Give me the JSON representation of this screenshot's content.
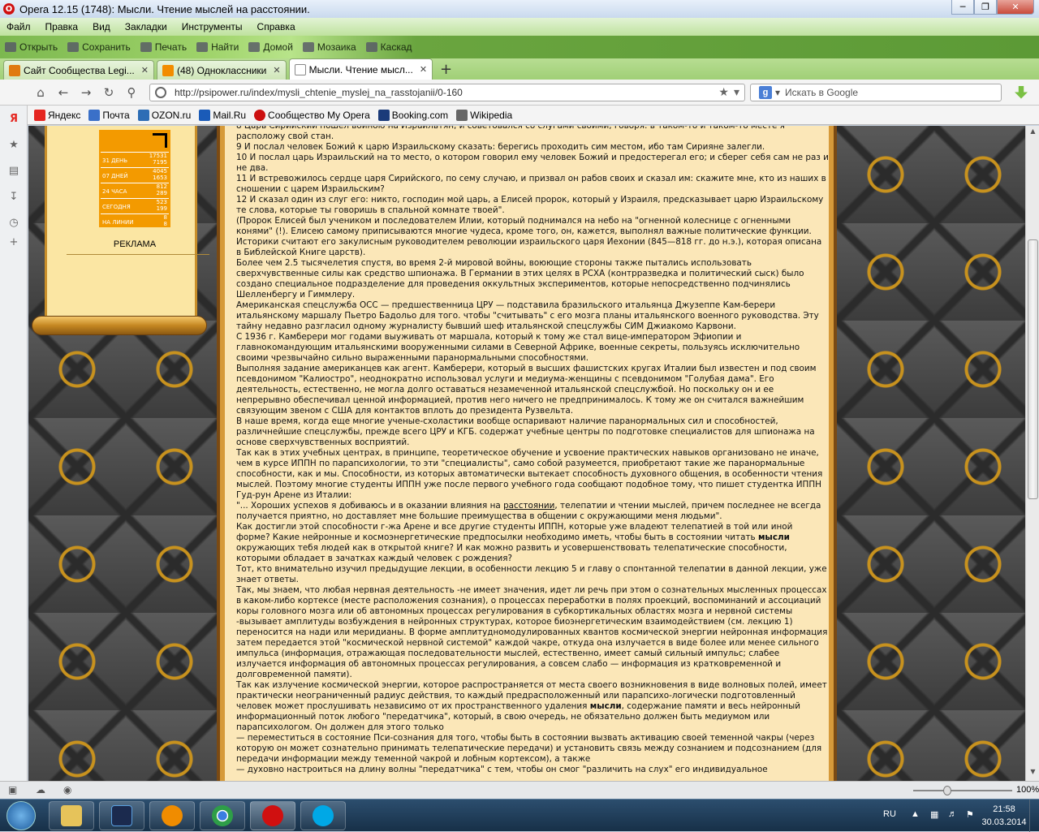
{
  "window": {
    "title": "Opera 12.15 (1748): Мысли. Чтение мыслей на расстоянии.",
    "controls": [
      "minimize",
      "maximize",
      "close"
    ]
  },
  "menu": [
    "Файл",
    "Правка",
    "Вид",
    "Закладки",
    "Инструменты",
    "Справка"
  ],
  "toolbar": [
    "Открыть",
    "Сохранить",
    "Печать",
    "Найти",
    "Домой",
    "Мозаика",
    "Каскад"
  ],
  "tabs": [
    {
      "label": "Сайт Сообщества Legi...",
      "icon": "legion-favicon",
      "color": "#e07a10"
    },
    {
      "label": "(48) Одноклассники",
      "icon": "ok-favicon",
      "color": "#f28c00"
    },
    {
      "label": "Мысли. Чтение мысл...",
      "icon": "page-favicon",
      "color": "#ffffff",
      "active": true
    }
  ],
  "address": {
    "url": "http://psipower.ru/index/mysli_chtenie_myslej_na_rasstojanii/0-160",
    "search_placeholder": "Искать в Google"
  },
  "bookmarks": [
    {
      "label": "Яндекс",
      "icon": "yandex-icon",
      "color": "#e52620"
    },
    {
      "label": "Почта",
      "icon": "mail-icon",
      "color": "#3a70c8"
    },
    {
      "label": "OZON.ru",
      "icon": "ozon-icon",
      "color": "#2d6db5"
    },
    {
      "label": "Mail.Ru",
      "icon": "mailru-icon",
      "color": "#1a5bb8"
    },
    {
      "label": "Сообщество My Opera",
      "icon": "opera-icon",
      "color": "#cc1010"
    },
    {
      "label": "Booking.com",
      "icon": "booking-icon",
      "color": "#1b3b7a"
    },
    {
      "label": "Wikipedia",
      "icon": "wikipedia-icon",
      "color": "#666666"
    }
  ],
  "counter": {
    "rows": [
      {
        "label": "31 ДЕНЬ",
        "v1": "17531",
        "v2": "7195"
      },
      {
        "label": "07 ДНЕЙ",
        "v1": "4045",
        "v2": "1653"
      },
      {
        "label": "24 ЧАСА",
        "v1": "812",
        "v2": "289"
      },
      {
        "label": "СЕГОДНЯ",
        "v1": "523",
        "v2": "199"
      },
      {
        "label": "НА ЛИНИИ",
        "v1": "8",
        "v2": "8"
      }
    ],
    "color": "#f39a00"
  },
  "sidebar": {
    "ad_label": "РЕКЛАМА"
  },
  "article": {
    "paragraphs": [
      "8 Царь Сирийский пошел войною на Израильтян, и советовался со слугами своими, говоря: в таком-то и таком-то месте я расположу свой стан.",
      "9 И послал человек Божий к царю Израильскому сказать: берегись проходить сим местом, ибо там Сирияне залегли.",
      "10 И послал царь Израильский на то место, о котором говорил ему человек Божий и предостерегал его; и сберег себя сам не раз и не два.",
      "11 И встревожилось сердце царя Сирийского, по сему случаю, и призвал он рабов своих и сказал им: скажите мне, кто из наших в сношении с царем Израильским?",
      "12 И сказал один из слуг его: никто, господин мой царь, а Елисей пророк, который у Израиля, предсказывает царю Израильскому те слова, которые ты говоришь в спальной комнате твоей\".",
      "(Пророк Елисей был учеником и последователем Илии, который поднимался на небо на \"огненной колеснице с огненными конями\" (!). Елисею самому приписываются многие чудеса, кроме того, он, кажется, выполнял важные политические функции. Историки считают его закулисным руководителем революции израильского царя Иехонии (845—818 гг. до н.э.), которая описана в Библейской Книге царств).",
      "Более чем 2.5 тысячелетия спустя, во время 2-й мировой войны, воюющие стороны также пытались использовать сверхчувственные силы как средство шпионажа. В Германии в этих целях в РСХА (контрразведка и политический сыск) было создано специальное подразделение для проведения оккультных экспериментов, которые непосредственно подчинялись Шелленбергу и Гиммлеру.",
      "Американская спецслужба ОСС — предшественница ЦРУ — подставила бразильского итальянца Джузеппе Кам-берери итальянскому маршалу Пьетро Бадольо для того. чтобы \"считывать\" с его мозга планы итальянского военного руководства. Эту тайну недавно разгласил одному журналисту бывший шеф итальянской спецслужбы СИМ Джиакомо Карвони.",
      "С 1936 г. Камберери мог годами выуживать от маршала, который к тому же стал вице-императором Эфиопии и главнокомандующим итальянскими вооруженными силами в Северной Африке, военные секреты, пользуясь исключительно своими чрезвычайно сильно выраженными паранормальными способностями.",
      "Выполняя задание американцев как агент. Камберери, который в высших фашистских кругах Италии был известен и под своим псевдонимом \"Калиостро\", неоднократно использовал услуги и медиума-женщины с псевдонимом \"Голубая дама\". Его деятельность, естественно, не могла долго оставаться незамеченной итальянской спецслужбой. Но поскольку он и ее непрерывно обеспечивал ценной информацией, против него ничего не предпринималось. К тому же он считался важнейшим связующим звеном с США для контактов вплоть до президента Рузвельта.",
      "В наше время, когда еще многие ученые-схоластики вообще оспаривают наличие паранормальных сил и способностей, различнейшие спецслужбы, прежде всего ЦРУ и КГБ. содержат учебные центры по подготовке специалистов для шпионажа на основе сверхчувственных восприятий.",
      "Так как в этих учебных центрах, в принципе, теоретическое обучение и усвоение практических навыков организовано не иначе, чем в курсе ИППН по парапсихологии, то эти \"специалисты\", само собой разумеется, приобретают такие же паранормальные способности, как и мы. Способности, из которых автоматически вытекает способность духовного общения, в особенности чтения мыслей. Поэтому многие студенты ИППН уже после первого учебного года сообщают подобное тому, что пишет студентка ИППН Гуд-рун Арене из Италии:",
      "\"... Хороших успехов я добиваюсь и в оказании влияния на [расстоянии], телепатии и чтении мыслей, причем последнее не всегда получается приятно, но доставляет мне большие преимущества в общении с окружающими меня людьми\".",
      "Как достигли этой способности г-жа Арене и все другие студенты ИППН, которые уже владеют телепатией в той или иной форме? Какие нейронные и космоэнергетические предпосылки необходимо иметь, чтобы быть в состоянии читать {мысли} окружающих тебя людей как в открытой книге? И как можно развить и усовершенствовать телепатические способности, которыми обладает в зачатках каждый человек с рождения?",
      "Тот, кто внимательно изучил предыдущие лекции, в особенности лекцию 5 и главу о спонтанной телепатии в данной лекции, уже знает ответы.",
      "Так, мы знаем, что любая нервная деятельность -не имеет значения, идет ли речь при этом о сознательных мысленных процессах в каком-либо кортексе (месте расположения сознания), о процессах переработки в полях проекций, воспоминаний и ассоциаций коры головного мозга или об автономных процессах регулирования в субкортикальных областях мозга и нервной системы -вызывает амплитуды возбуждения в нейронных структурах, которое биоэнергетическим взаимодействием (см. лекцию 1) переносится на нади или меридианы. В форме амплитудномодулированных квантов космической энергии нейронная информация затем передается этой \"космической нервной системой\" каждой чакре, откуда она излучается в виде более или менее сильного импульса (информация, отражающая последовательности мыслей, естественно, имеет самый сильный импульс; слабее излучается информация об автономных процессах регулирования, а совсем слабо — информация из кратковременной и долговременной памяти).",
      "Так как излучение космической энергии, которое распространяется от места своего возникновения в виде волновых полей, имеет практически неограниченный радиус действия, то каждый предрасположенный или парапсихо-логически подготовленный человек может прослушивать независимо от их пространственного удаления {мысли}, содержание памяти и весь нейронный информационный поток любого \"передатчика\", который, в свою очередь, не обязательно должен быть медиумом или парапсихологом. Он должен для этого только",
      "— переместиться в состояние Пси-сознания для того, чтобы быть в состоянии вызвать активацию своей теменной чакры (через которую он может сознательно принимать телепатические передачи) и установить связь между сознанием и подсознанием (для передачи информации между теменной чакрой и лобным кортексом), а также",
      "— духовно настроиться на длину волны \"передатчика\" с тем, чтобы он смог \"различить на слух\" его индивидуальное"
    ],
    "link_word": "расстоянии",
    "bold_word": "мысли"
  },
  "statusbar": {
    "zoom": "100%",
    "zoom_level": 0.5
  },
  "taskbar": {
    "apps": [
      {
        "name": "explorer",
        "color": "#e6c35a"
      },
      {
        "name": "photoshop",
        "color": "#1b2a4e"
      },
      {
        "name": "vlc",
        "color": "#f08c00"
      },
      {
        "name": "chrome",
        "color": "#2e9e48"
      },
      {
        "name": "opera",
        "color": "#d01010"
      },
      {
        "name": "skype",
        "color": "#00a8e6"
      }
    ],
    "lang": "RU",
    "time": "21:58",
    "date": "30.03.2014"
  }
}
